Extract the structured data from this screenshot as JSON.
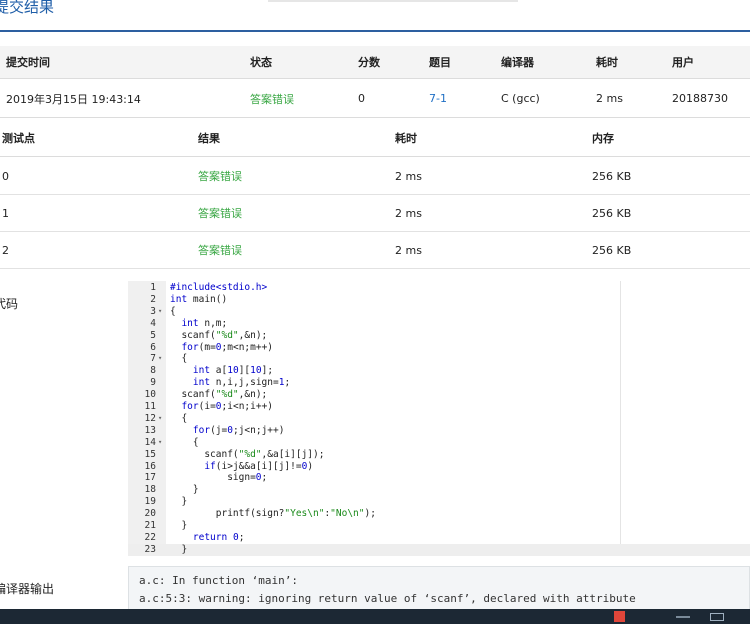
{
  "page": {
    "title": "提交结果"
  },
  "submission": {
    "headers": [
      "提交时间",
      "状态",
      "分数",
      "题目",
      "编译器",
      "耗时",
      "用户"
    ],
    "row": {
      "time": "2019年3月15日 19:43:14",
      "status": "答案错误",
      "score": "0",
      "problem": "7-1",
      "compiler": "C (gcc)",
      "elapsed": "2 ms",
      "user": "20188730"
    }
  },
  "tests": {
    "headers": [
      "测试点",
      "结果",
      "耗时",
      "内存"
    ],
    "rows": [
      {
        "id": "0",
        "result": "答案错误",
        "time": "2 ms",
        "memory": "256 KB"
      },
      {
        "id": "1",
        "result": "答案错误",
        "time": "2 ms",
        "memory": "256 KB"
      },
      {
        "id": "2",
        "result": "答案错误",
        "time": "2 ms",
        "memory": "256 KB"
      }
    ]
  },
  "code_section": {
    "label": "代码",
    "lines": [
      {
        "n": "1",
        "fold": false,
        "html": "<span class='pp'>#include</span><span class='pp'>&lt;stdio.h&gt;</span>"
      },
      {
        "n": "2",
        "fold": false,
        "html": "<span class='kw'>int</span> main()"
      },
      {
        "n": "3",
        "fold": true,
        "html": "{"
      },
      {
        "n": "4",
        "fold": false,
        "html": "  <span class='kw'>int</span> n,m;"
      },
      {
        "n": "5",
        "fold": false,
        "html": "  scanf(<span class='str'>\"%d\"</span>,&amp;n);"
      },
      {
        "n": "6",
        "fold": false,
        "html": "  <span class='kw'>for</span>(m=<span class='num'>0</span>;m&lt;n;m++)"
      },
      {
        "n": "7",
        "fold": true,
        "html": "  {"
      },
      {
        "n": "8",
        "fold": false,
        "html": "    <span class='kw'>int</span> a[<span class='num'>10</span>][<span class='num'>10</span>];"
      },
      {
        "n": "9",
        "fold": false,
        "html": "    <span class='kw'>int</span> n,i,j,sign=<span class='num'>1</span>;"
      },
      {
        "n": "10",
        "fold": false,
        "html": "  scanf(<span class='str'>\"%d\"</span>,&amp;n);"
      },
      {
        "n": "11",
        "fold": false,
        "html": "  <span class='kw'>for</span>(i=<span class='num'>0</span>;i&lt;n;i++)"
      },
      {
        "n": "12",
        "fold": true,
        "html": "  {"
      },
      {
        "n": "13",
        "fold": false,
        "html": "    <span class='kw'>for</span>(j=<span class='num'>0</span>;j&lt;n;j++)"
      },
      {
        "n": "14",
        "fold": true,
        "html": "    {"
      },
      {
        "n": "15",
        "fold": false,
        "html": "      scanf(<span class='str'>\"%d\"</span>,&amp;a[i][j]);"
      },
      {
        "n": "16",
        "fold": false,
        "html": "      <span class='kw'>if</span>(i&gt;j&amp;&amp;a[i][j]!=<span class='num'>0</span>)"
      },
      {
        "n": "17",
        "fold": false,
        "html": "          sign=<span class='num'>0</span>;"
      },
      {
        "n": "18",
        "fold": false,
        "html": "    }"
      },
      {
        "n": "19",
        "fold": false,
        "html": "  }"
      },
      {
        "n": "20",
        "fold": false,
        "html": "        printf(sign?<span class='str'>\"Yes\\n\"</span>:<span class='str'>\"No\\n\"</span>);"
      },
      {
        "n": "21",
        "fold": false,
        "html": "  }"
      },
      {
        "n": "22",
        "fold": false,
        "html": "    <span class='kw'>return</span> <span class='num'>0</span>;"
      },
      {
        "n": "23",
        "fold": false,
        "html": "  }"
      }
    ]
  },
  "compiler_output": {
    "label": "编译器输出",
    "lines": [
      "a.c: In function ‘main’:",
      "a.c:5:3: warning: ignoring return value of ‘scanf’, declared with attribute"
    ]
  },
  "colors": {
    "accent": "#1f5ea8",
    "status_wrong": "#3aa744",
    "link": "#1f6fc5"
  }
}
